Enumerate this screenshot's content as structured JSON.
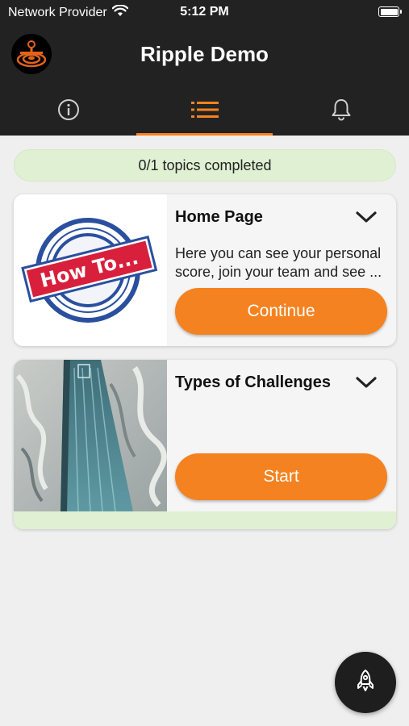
{
  "status_bar": {
    "carrier": "Network Provider",
    "time": "5:12 PM"
  },
  "header": {
    "title": "Ripple Demo"
  },
  "tabs": [
    {
      "icon": "info-icon",
      "active": false
    },
    {
      "icon": "list-icon",
      "active": true
    },
    {
      "icon": "bell-icon",
      "active": false
    }
  ],
  "progress": {
    "label": "0/1 topics completed",
    "completed": 0,
    "total": 1
  },
  "topics": [
    {
      "title": "Home Page",
      "description_lines": [
        "Here you can see your personal",
        "score, join your team and see ..."
      ],
      "button_label": "Continue",
      "image_text": "How To..."
    },
    {
      "title": "Types of Challenges",
      "description_lines": [],
      "button_label": "Start"
    }
  ],
  "colors": {
    "accent": "#f58220",
    "header_bg": "#222222",
    "progress_bg": "#dff0d3",
    "page_bg": "#efefef"
  }
}
